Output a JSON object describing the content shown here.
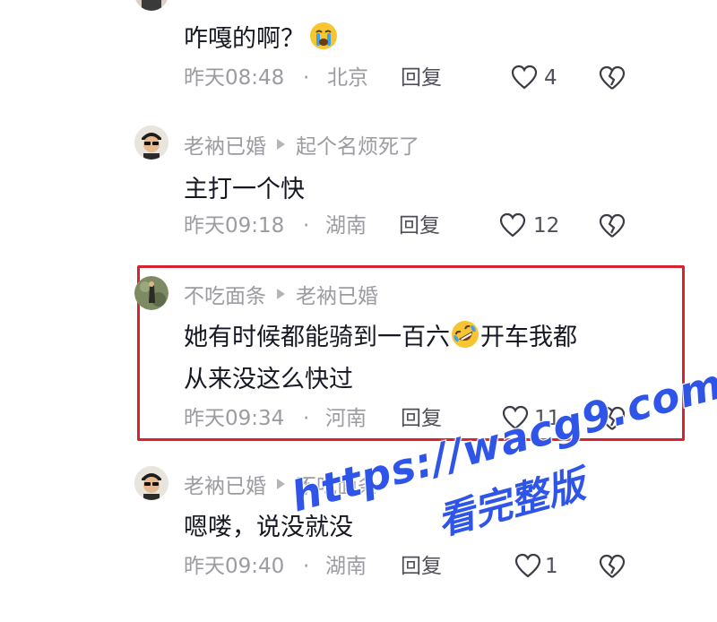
{
  "comments": [
    {
      "username": "",
      "reply_to": "",
      "lines": [
        "咋嘎的啊？"
      ],
      "emoji": "crying-face",
      "time": "昨天08:48",
      "location": "北京",
      "reply_label": "回复",
      "likes": "4"
    },
    {
      "username": "老衲已婚",
      "reply_to": "起个名烦死了",
      "lines": [
        "主打一个快"
      ],
      "time": "昨天09:18",
      "location": "湖南",
      "reply_label": "回复",
      "likes": "12"
    },
    {
      "username": "不吃面条",
      "reply_to": "老衲已婚",
      "lines": [
        "她有时候都能骑到一百六",
        "开车我都",
        "从来没这么快过"
      ],
      "emoji": "rolling-on-floor-laughing",
      "time": "昨天09:34",
      "location": "河南",
      "reply_label": "回复",
      "likes": "11"
    },
    {
      "username": "老衲已婚",
      "reply_to": "不吃面条",
      "lines": [
        "嗯喽，说没就没"
      ],
      "time": "昨天09:40",
      "location": "湖南",
      "reply_label": "回复",
      "likes": "1"
    }
  ],
  "separator": "·",
  "watermark": {
    "url": "https://wacg9.com",
    "text": "看完整版"
  },
  "colors": {
    "highlight": "#d7232f",
    "watermark": "#2f55e8",
    "meta_text": "#9b9ba1"
  }
}
